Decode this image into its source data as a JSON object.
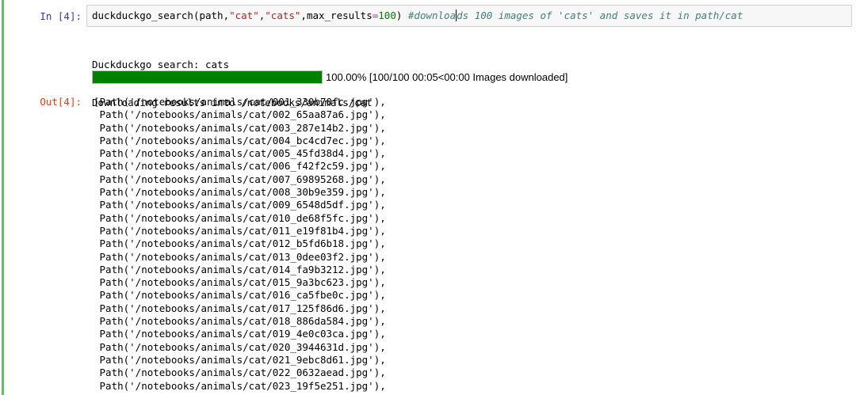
{
  "cell": {
    "in_prompt": "In [4]:",
    "out_prompt": "Out[4]:",
    "code": {
      "fn": "duckduckgo_search",
      "open": "(path,",
      "arg1": "\"cat\"",
      "comma1": ",",
      "arg2": "\"cats\"",
      "comma2": ",max_results",
      "eq": "=",
      "num": "100",
      "close": ") ",
      "comment_a": "#downloa",
      "comment_b": "ds 100 images of 'cats' and saves it in path/cat"
    },
    "stream_lines": [
      "Duckduckgo search: cats",
      "Downloading results into /notebooks/animals/cat"
    ],
    "progress": {
      "fraction": 1.0,
      "label": "100.00% [100/100 00:05<00:00 Images downloaded]"
    },
    "output_lines": [
      "[Path('/notebooks/animals/cat/001_330b70fc.jpg'),",
      " Path('/notebooks/animals/cat/002_65aa87a6.jpg'),",
      " Path('/notebooks/animals/cat/003_287e14b2.jpg'),",
      " Path('/notebooks/animals/cat/004_bc4cd7ec.jpg'),",
      " Path('/notebooks/animals/cat/005_45fd38d4.jpg'),",
      " Path('/notebooks/animals/cat/006_f42f2c59.jpg'),",
      " Path('/notebooks/animals/cat/007_69895268.jpg'),",
      " Path('/notebooks/animals/cat/008_30b9e359.jpg'),",
      " Path('/notebooks/animals/cat/009_6548d5df.jpg'),",
      " Path('/notebooks/animals/cat/010_de68f5fc.jpg'),",
      " Path('/notebooks/animals/cat/011_e19f81b4.jpg'),",
      " Path('/notebooks/animals/cat/012_b5fd6b18.jpg'),",
      " Path('/notebooks/animals/cat/013_0dee03f2.jpg'),",
      " Path('/notebooks/animals/cat/014_fa9b3212.jpg'),",
      " Path('/notebooks/animals/cat/015_9a3bc623.jpg'),",
      " Path('/notebooks/animals/cat/016_ca5fbe0c.jpg'),",
      " Path('/notebooks/animals/cat/017_125f86d6.jpg'),",
      " Path('/notebooks/animals/cat/018_886da584.jpg'),",
      " Path('/notebooks/animals/cat/019_4e0c03ca.jpg'),",
      " Path('/notebooks/animals/cat/020_3944631d.jpg'),",
      " Path('/notebooks/animals/cat/021_9ebc8d61.jpg'),",
      " Path('/notebooks/animals/cat/022_0632aead.jpg'),",
      " Path('/notebooks/animals/cat/023_19f5e251.jpg'),"
    ]
  },
  "colors": {
    "cell_border": "#66bb6a",
    "progress_fill": "#008000",
    "in_prompt": "#303f9f",
    "out_prompt": "#d84315"
  }
}
